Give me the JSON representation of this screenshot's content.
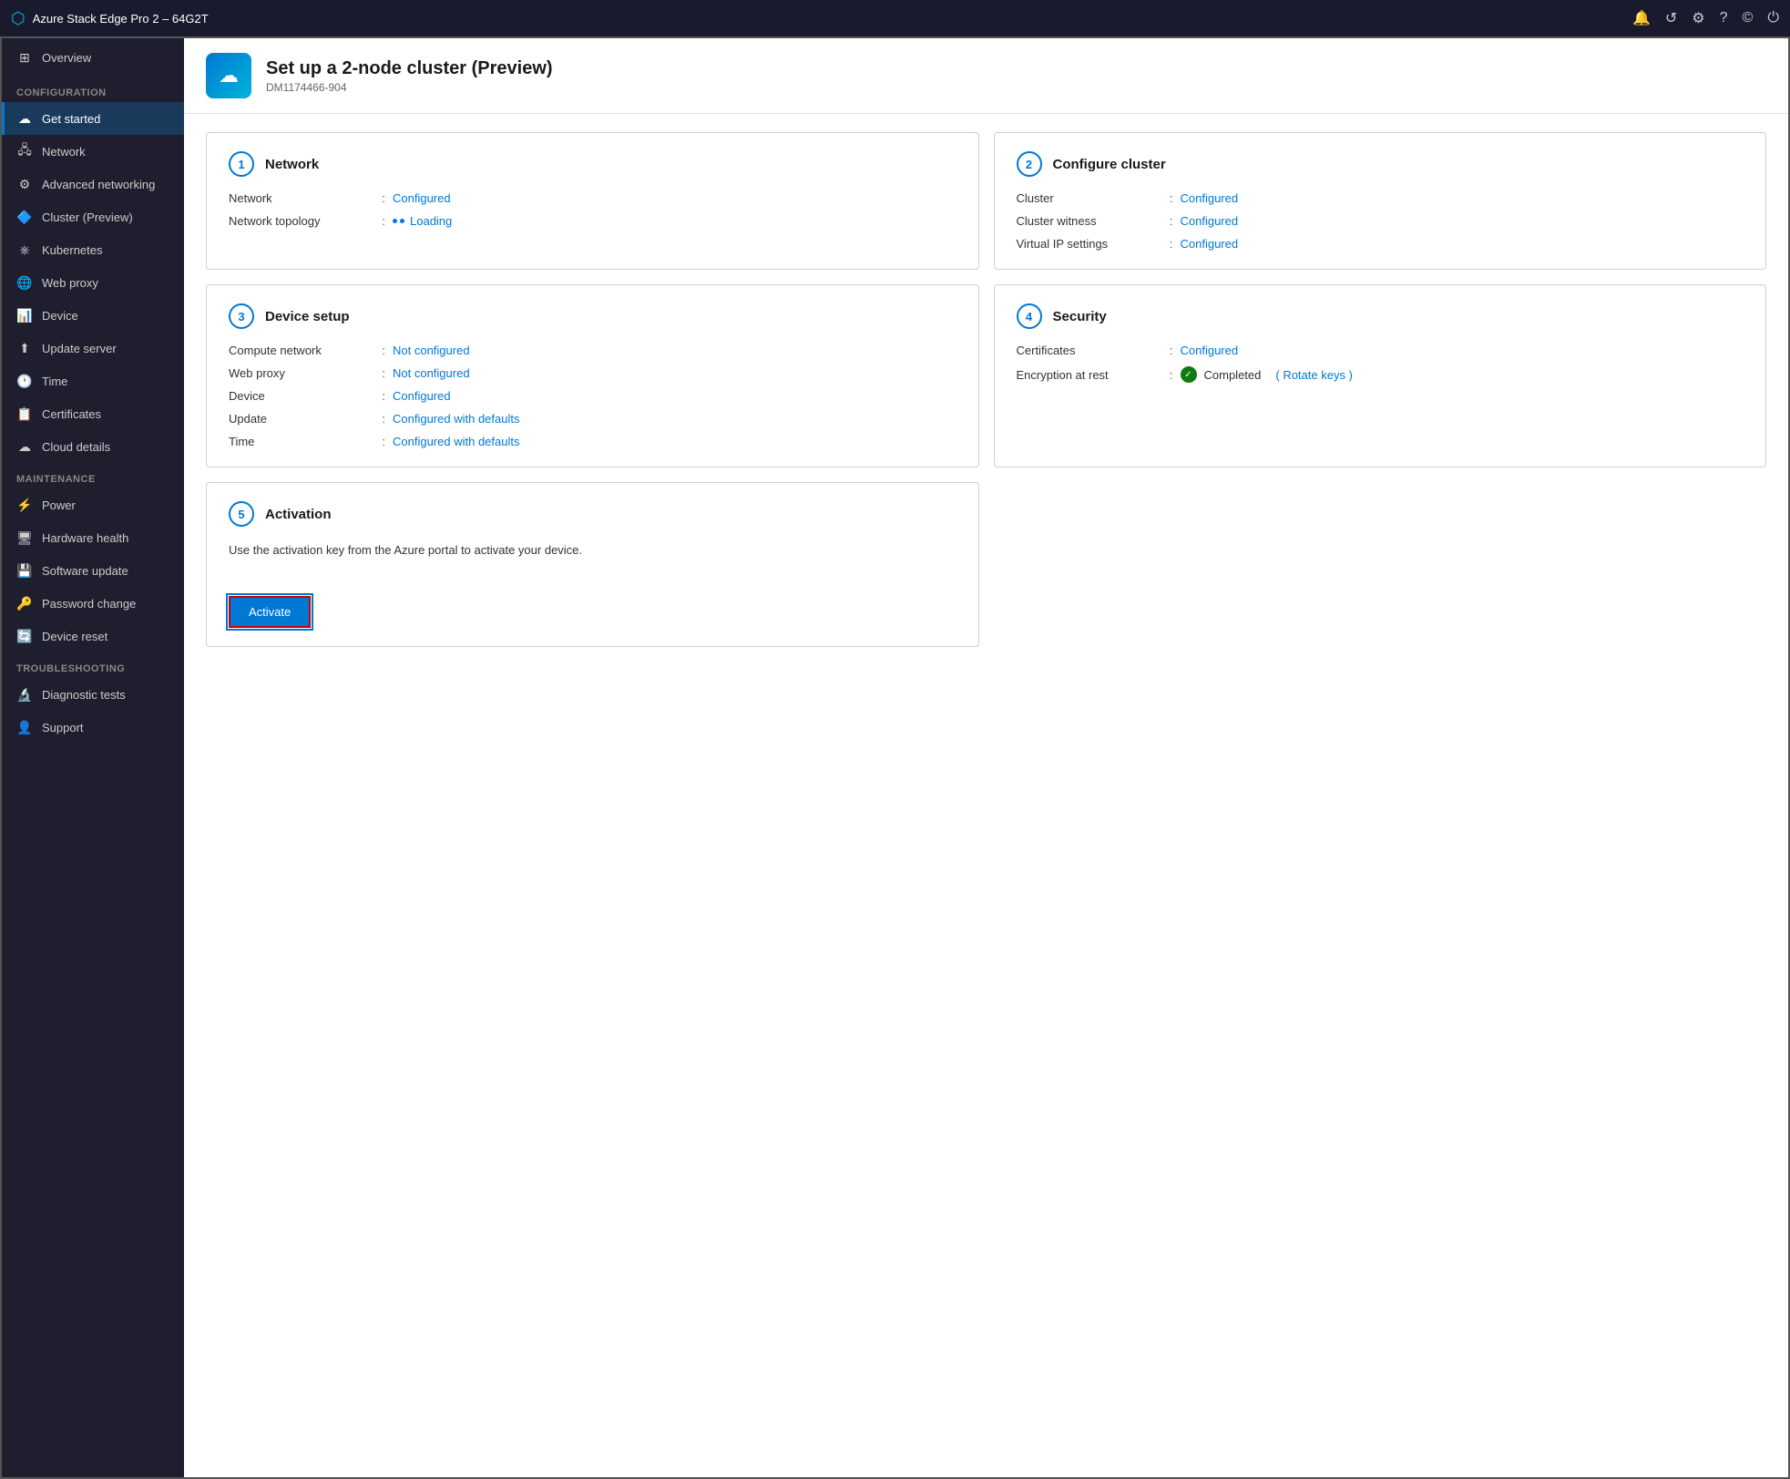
{
  "titlebar": {
    "title": "Azure Stack Edge Pro 2 – 64G2T",
    "icons": [
      "bell",
      "refresh",
      "settings",
      "help",
      "account",
      "power"
    ]
  },
  "sidebar": {
    "overview_label": "Overview",
    "sections": [
      {
        "label": "CONFIGURATION",
        "items": [
          {
            "id": "get-started",
            "label": "Get started",
            "icon": "☁",
            "active": true
          },
          {
            "id": "network",
            "label": "Network",
            "icon": "🖧",
            "active": false
          },
          {
            "id": "advanced-networking",
            "label": "Advanced networking",
            "icon": "⚙",
            "active": false
          },
          {
            "id": "cluster",
            "label": "Cluster (Preview)",
            "icon": "🔷",
            "active": false
          },
          {
            "id": "kubernetes",
            "label": "Kubernetes",
            "icon": "⎈",
            "active": false
          },
          {
            "id": "web-proxy",
            "label": "Web proxy",
            "icon": "🌐",
            "active": false
          },
          {
            "id": "device",
            "label": "Device",
            "icon": "📊",
            "active": false
          },
          {
            "id": "update-server",
            "label": "Update server",
            "icon": "⬆",
            "active": false
          },
          {
            "id": "time",
            "label": "Time",
            "icon": "🕐",
            "active": false
          },
          {
            "id": "certificates",
            "label": "Certificates",
            "icon": "📋",
            "active": false
          },
          {
            "id": "cloud-details",
            "label": "Cloud details",
            "icon": "☁",
            "active": false
          }
        ]
      },
      {
        "label": "MAINTENANCE",
        "items": [
          {
            "id": "power",
            "label": "Power",
            "icon": "⚡",
            "active": false
          },
          {
            "id": "hardware-health",
            "label": "Hardware health",
            "icon": "🖥",
            "active": false
          },
          {
            "id": "software-update",
            "label": "Software update",
            "icon": "💾",
            "active": false
          },
          {
            "id": "password-change",
            "label": "Password change",
            "icon": "🔑",
            "active": false
          },
          {
            "id": "device-reset",
            "label": "Device reset",
            "icon": "🔄",
            "active": false
          }
        ]
      },
      {
        "label": "TROUBLESHOOTING",
        "items": [
          {
            "id": "diagnostic-tests",
            "label": "Diagnostic tests",
            "icon": "🔬",
            "active": false
          },
          {
            "id": "support",
            "label": "Support",
            "icon": "👤",
            "active": false
          }
        ]
      }
    ]
  },
  "page": {
    "logo_icon": "☁",
    "title": "Set up a 2-node cluster (Preview)",
    "subtitle": "DM1174466-904"
  },
  "cards": [
    {
      "number": "1",
      "title": "Network",
      "rows": [
        {
          "label": "Network",
          "value": "Configured",
          "type": "configured"
        },
        {
          "label": "Network topology",
          "value": "Loading",
          "type": "loading"
        }
      ]
    },
    {
      "number": "2",
      "title": "Configure cluster",
      "rows": [
        {
          "label": "Cluster",
          "value": "Configured",
          "type": "configured"
        },
        {
          "label": "Cluster witness",
          "value": "Configured",
          "type": "configured"
        },
        {
          "label": "Virtual IP settings",
          "value": "Configured",
          "type": "configured"
        }
      ]
    },
    {
      "number": "3",
      "title": "Device setup",
      "rows": [
        {
          "label": "Compute network",
          "value": "Not configured",
          "type": "not-configured"
        },
        {
          "label": "Web proxy",
          "value": "Not configured",
          "type": "not-configured"
        },
        {
          "label": "Device",
          "value": "Configured",
          "type": "configured"
        },
        {
          "label": "Update",
          "value": "Configured with defaults",
          "type": "configured"
        },
        {
          "label": "Time",
          "value": "Configured with defaults",
          "type": "configured"
        }
      ]
    },
    {
      "number": "4",
      "title": "Security",
      "rows": [
        {
          "label": "Certificates",
          "value": "Configured",
          "type": "configured"
        },
        {
          "label": "Encryption at rest",
          "value": "Completed",
          "type": "completed",
          "extra": "( Rotate keys )"
        }
      ]
    },
    {
      "number": "5",
      "title": "Activation",
      "description": "Use the activation key from the Azure portal to activate your device.",
      "button_label": "Activate"
    }
  ]
}
